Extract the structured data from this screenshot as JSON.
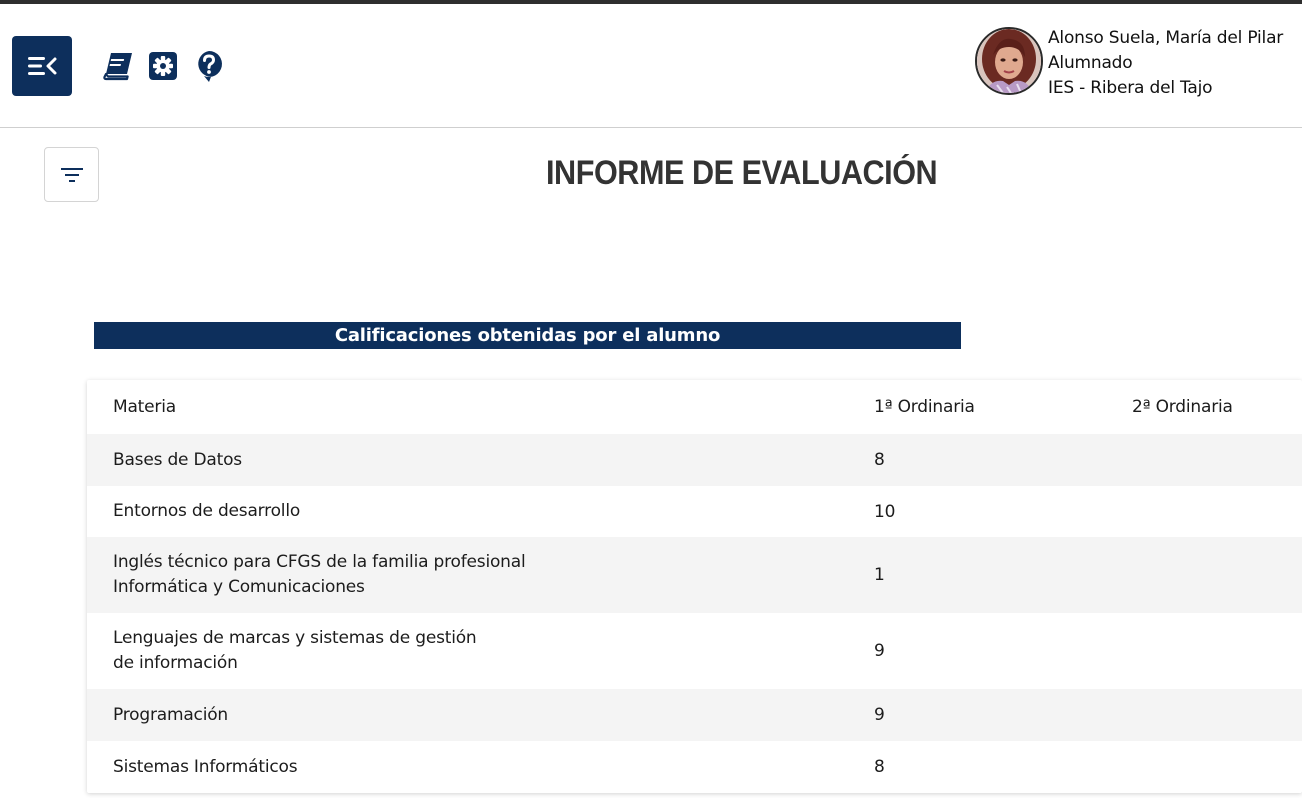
{
  "colors": {
    "primary": "#0d2f5c",
    "row_alt": "#f4f4f4",
    "text": "#222222"
  },
  "header": {
    "menu_icon": "menu-collapse-icon",
    "toolbar_icons": [
      "book-icon",
      "gear-icon",
      "help-icon"
    ],
    "user": {
      "name": "Alonso Suela, María del Pilar",
      "role": "Alumnado",
      "school": "IES - Ribera del Tajo"
    }
  },
  "page": {
    "title": "INFORME DE EVALUACIÓN",
    "filter_icon": "filter-icon"
  },
  "grades": {
    "section_title": "Calificaciones obtenidas por el alumno",
    "columns": [
      "Materia",
      "1ª Ordinaria",
      "2ª Ordinaria"
    ],
    "rows": [
      {
        "materia": [
          "Bases de Datos"
        ],
        "ord1": "8",
        "ord2": ""
      },
      {
        "materia": [
          "Entornos de desarrollo"
        ],
        "ord1": "10",
        "ord2": ""
      },
      {
        "materia": [
          "Inglés técnico para CFGS de la familia profesional",
          "Informática y Comunicaciones"
        ],
        "ord1": "1",
        "ord2": ""
      },
      {
        "materia": [
          "Lenguajes de marcas y sistemas de gestión",
          "de información"
        ],
        "ord1": "9",
        "ord2": ""
      },
      {
        "materia": [
          "Programación"
        ],
        "ord1": "9",
        "ord2": ""
      },
      {
        "materia": [
          "Sistemas Informáticos"
        ],
        "ord1": "8",
        "ord2": ""
      }
    ]
  }
}
